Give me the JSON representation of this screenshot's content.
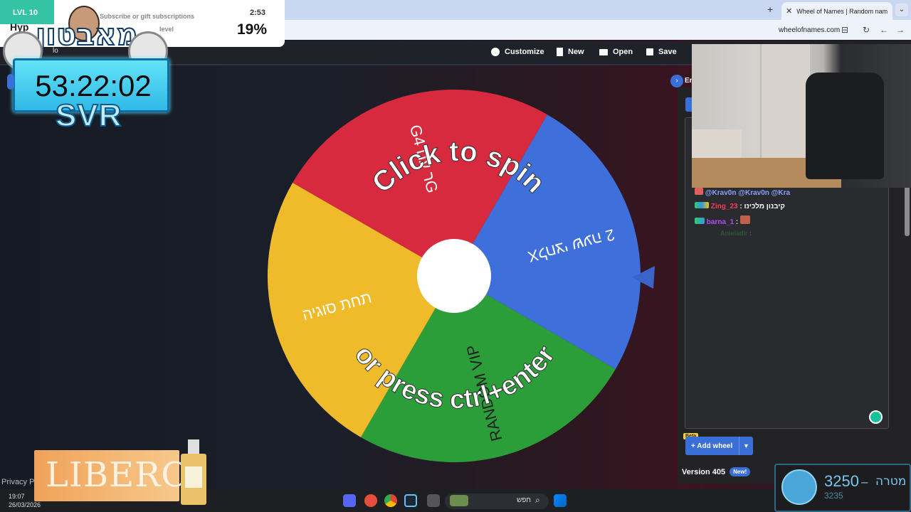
{
  "browser": {
    "tab_title": "Wheel of Names | Random nam",
    "new_tab_icon": "+",
    "url": "wheelofnames.com"
  },
  "toolbar": {
    "customize_label": "Customize",
    "new_label": "New",
    "open_label": "Open",
    "save_label": "Save"
  },
  "wheel": {
    "top_caption": "Click to spin",
    "bottom_caption": "or press ctrl+enter",
    "segments": [
      {
        "label": "Gר עם 4G",
        "color": "#d72a3f"
      },
      {
        "label": "לחצי שעה 2X",
        "color": "#3f6fdb"
      },
      {
        "label": "RANDOM VIP",
        "color": "#2b9e3a"
      },
      {
        "label": "תחת סוגיה",
        "color": "#f0bb2a"
      }
    ],
    "pointer_color": "#3a64c8"
  },
  "overlay": {
    "level": "LVL 10",
    "hype_prefix": "Hyp",
    "subscribe_text": "Subscribe or gift subscriptions",
    "level_text": "level",
    "hype_time": "2:53",
    "hype_percent": "19%",
    "channel_title": "מאבטון",
    "lo_text": "lo",
    "timer": "53:22:02",
    "svr": "SVR"
  },
  "panel": {
    "entries_label": "En",
    "chat": [
      {
        "user": "@Krav0n @Krav0n @Kra",
        "color": "#8aa0ff",
        "text": ""
      },
      {
        "user": "Zing_23",
        "color": "#ff3b5c",
        "text": ": קיבנון מלכינו"
      },
      {
        "user": "barna_1",
        "color": "#b14cff",
        "text": ":"
      },
      {
        "user": "Anieladir",
        "color": "#2b8a3e",
        "text": ":"
      }
    ],
    "beta_label": "Beta",
    "add_wheel_label": "Add wheel",
    "version_label": "Version 405",
    "new_badge": "New!"
  },
  "taskbar": {
    "time": "19:07",
    "date": "26/03/2026",
    "search_label": "חפש",
    "privacy": "Privacy P"
  },
  "ad": {
    "brand": "LIBERO"
  },
  "goal": {
    "value": "3250",
    "separator": "–",
    "current": "3235",
    "label": "מטרה"
  }
}
